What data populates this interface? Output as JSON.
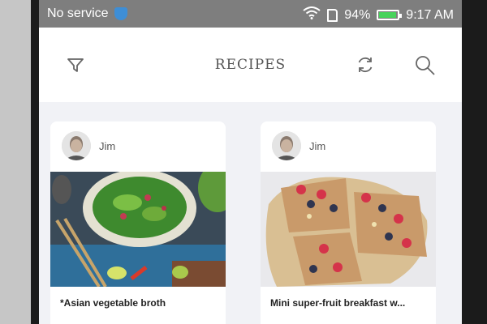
{
  "status_bar": {
    "carrier": "No service",
    "battery_percent": "94%",
    "battery_level": 0.94,
    "time": "9:17 AM",
    "icons": [
      "shield-icon",
      "wifi-icon",
      "sim-icon",
      "battery-icon"
    ]
  },
  "app_bar": {
    "title": "RECIPES",
    "icons": [
      "filter-icon",
      "refresh-icon",
      "search-icon"
    ]
  },
  "recipes": [
    {
      "author": "Jim",
      "title": "*Asian vegetable broth"
    },
    {
      "author": "Jim",
      "title": "Mini super-fruit breakfast w..."
    }
  ],
  "colors": {
    "status_bar_bg": "#7e7e7e",
    "battery_green": "#47d35b",
    "shield_blue": "#3e8ed6",
    "screen_bg": "#f1f2f6"
  }
}
